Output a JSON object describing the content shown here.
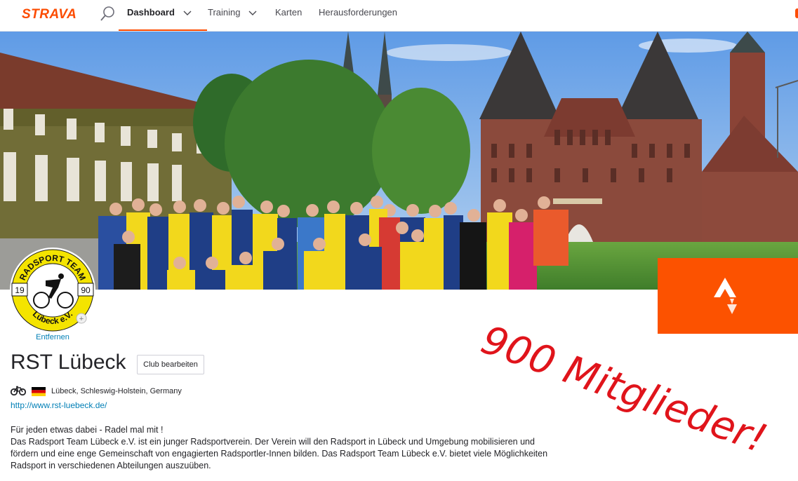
{
  "nav": {
    "logo": "STRAVA",
    "items": [
      {
        "label": "Dashboard",
        "active": true,
        "has_dropdown": true
      },
      {
        "label": "Training",
        "active": false,
        "has_dropdown": true
      },
      {
        "label": "Karten",
        "active": false,
        "has_dropdown": false
      },
      {
        "label": "Herausforderungen",
        "active": false,
        "has_dropdown": false
      }
    ],
    "search_icon": "search-icon"
  },
  "colors": {
    "brand": "#fc4c02",
    "badge": "#fc5200",
    "link": "#007fb6",
    "annotation": "#e0141b",
    "club_yellow": "#f4e400"
  },
  "banner": {
    "photo": "cover-photo-group-of-cyclists-in-front-of-holstentor"
  },
  "club": {
    "logo_text_top": "RADSPORT TEAM",
    "logo_year_left": "19",
    "logo_year_right": "90",
    "logo_text_bottom": "Lübeck e.V.",
    "remove_label": "Entfernen",
    "name": "RST Lübeck",
    "edit_label": "Club bearbeiten",
    "sport_icon": "bike-icon",
    "flag_icon": "germany-flag-icon",
    "location": "Lübeck, Schleswig-Holstein, Germany",
    "website": "http://www.rst-luebeck.de/",
    "description": [
      "Für jeden etwas dabei - Radel mal mit !",
      "Das Radsport Team Lübeck e.V. ist ein junger Radsportverein. Der Verein will den Radsport in Lübeck und Umgebung mobilisieren und",
      "fördern und eine enge Gemeinschaft von engagierten Radsportler-Innen bilden. Das Radsport Team Lübeck e.V. bietet viele Möglichkeiten",
      "Radsport in verschiedenen Abteilungen auszuüben."
    ]
  },
  "annotation": {
    "text": "900 Mitglieder!"
  }
}
